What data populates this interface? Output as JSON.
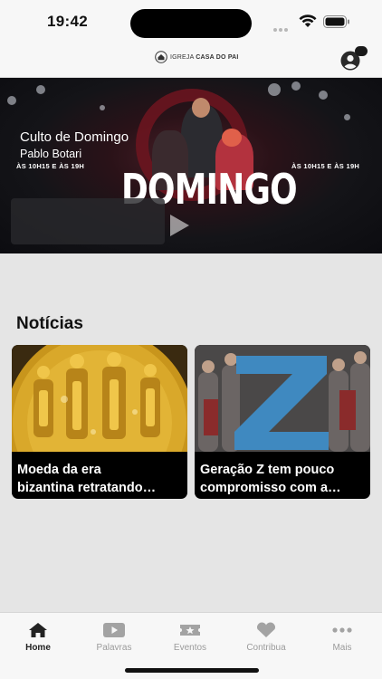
{
  "status_bar": {
    "time": "19:42"
  },
  "header": {
    "logo_prefix": "IGREJA",
    "logo_name": "CASA DO PAI",
    "profile_icon": "person-circle-icon"
  },
  "banner": {
    "event_word": "DOMINGO",
    "schedule_left": "ÀS 10H15 E ÀS 19H",
    "schedule_right": "ÀS 10H15 E ÀS 19H",
    "title": "Culto de Domingo",
    "author": "Pablo Botari",
    "play_icon": "play-icon"
  },
  "news": {
    "heading": "Notícias",
    "items": [
      {
        "line1": "Moeda da era",
        "line2": "bizantina retratando…",
        "image": "gold-coin-image"
      },
      {
        "line1": "Geração Z tem pouco",
        "line2": "compromisso com a…",
        "image": "generation-z-image"
      }
    ]
  },
  "tabs": [
    {
      "label": "Home",
      "icon": "home-icon",
      "active": true
    },
    {
      "label": "Palavras",
      "icon": "video-play-icon",
      "active": false
    },
    {
      "label": "Eventos",
      "icon": "ticket-star-icon",
      "active": false
    },
    {
      "label": "Contribua",
      "icon": "heart-icon",
      "active": false
    },
    {
      "label": "Mais",
      "icon": "more-dots-icon",
      "active": false
    }
  ],
  "colors": {
    "accent": "#222222",
    "inactive": "#9b9b9b",
    "background": "#e5e5e5"
  }
}
